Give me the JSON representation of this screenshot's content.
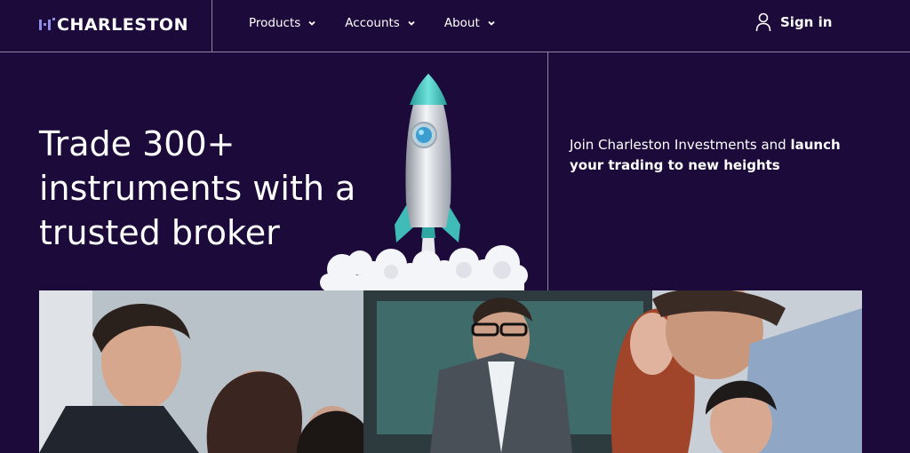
{
  "header": {
    "logo_text": "CHARLESTON",
    "nav": [
      {
        "label": "Products"
      },
      {
        "label": "Accounts"
      },
      {
        "label": "About"
      }
    ],
    "signin_label": "Sign in"
  },
  "hero": {
    "title_lines": [
      "Trade 300+",
      "instruments with a",
      "trusted broker"
    ],
    "tagline_regular": "Join Charleston Investments and ",
    "tagline_bold": "launch your trading to new heights"
  },
  "icons": {
    "logo": "charleston-logo-icon",
    "chevron": "chevron-down-icon",
    "signin": "user-icon"
  },
  "colors": {
    "background": "#1c0b3a",
    "divider": "#8f86a6",
    "logo_accent": "#8f8fe8",
    "rocket_accent": "#40c4c0"
  }
}
